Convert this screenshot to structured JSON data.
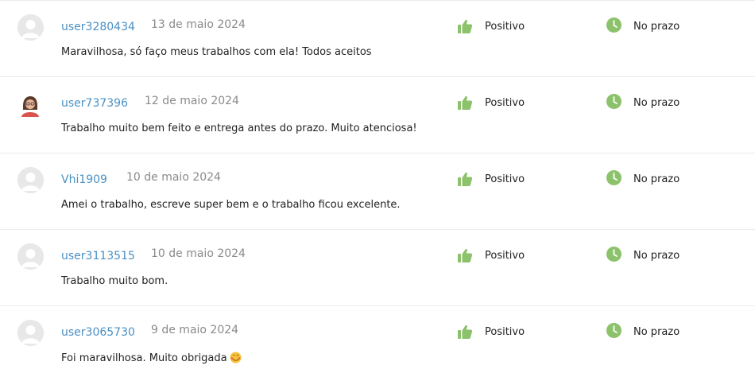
{
  "colors": {
    "link": "#4a90c4",
    "positive_icon": "#8cc26b",
    "on_time_icon": "#8cc26b",
    "date": "#8a8a8a",
    "divider": "#ebebeb"
  },
  "reviews": [
    {
      "username": "user3280434",
      "date": "13 de maio 2024",
      "comment": "Maravilhosa, só faço meus trabalhos com ela! Todos aceitos",
      "rating": "Positivo",
      "rating_icon": "thumbs-up-icon",
      "timeliness": "No prazo",
      "timeliness_icon": "clock-icon",
      "avatar": "default-avatar-icon"
    },
    {
      "username": "user737396",
      "date": "12 de maio 2024",
      "comment": "Trabalho muito bem feito e entrega antes do prazo. Muito atenciosa!",
      "rating": "Positivo",
      "rating_icon": "thumbs-up-icon",
      "timeliness": "No prazo",
      "timeliness_icon": "clock-icon",
      "avatar": "user-photo-avatar"
    },
    {
      "username": "Vhi1909",
      "date": "10 de maio 2024",
      "comment": "Amei o trabalho, escreve super bem e o trabalho ficou excelente.",
      "rating": "Positivo",
      "rating_icon": "thumbs-up-icon",
      "timeliness": "No prazo",
      "timeliness_icon": "clock-icon",
      "avatar": "default-avatar-icon"
    },
    {
      "username": "user3113515",
      "date": "10 de maio 2024",
      "comment": "Trabalho muito bom.",
      "rating": "Positivo",
      "rating_icon": "thumbs-up-icon",
      "timeliness": "No prazo",
      "timeliness_icon": "clock-icon",
      "avatar": "default-avatar-icon"
    },
    {
      "username": "user3065730",
      "date": "9 de maio 2024",
      "comment": "Foi maravilhosa. Muito obrigada",
      "comment_emoji": "smiling-face-hearts-emoji",
      "rating": "Positivo",
      "rating_icon": "thumbs-up-icon",
      "timeliness": "No prazo",
      "timeliness_icon": "clock-icon",
      "avatar": "default-avatar-icon"
    }
  ]
}
